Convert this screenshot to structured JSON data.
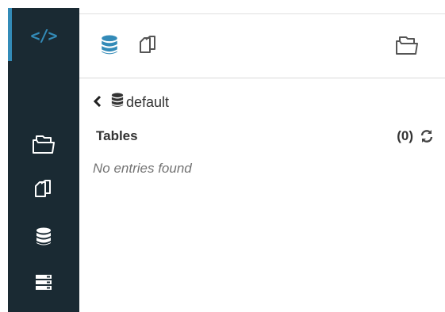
{
  "sidebar": {
    "items": [
      {
        "name": "editor",
        "icon": "code-icon",
        "active": true
      },
      {
        "name": "files",
        "icon": "folder-open-icon"
      },
      {
        "name": "documents",
        "icon": "documents-icon"
      },
      {
        "name": "tables",
        "icon": "database-icon"
      },
      {
        "name": "indexes",
        "icon": "server-icon"
      }
    ],
    "code_glyph": "</>"
  },
  "header": {
    "left_icons": [
      "database-icon",
      "documents-icon"
    ],
    "right_icon": "folder-open-icon"
  },
  "breadcrumb": {
    "label": "default"
  },
  "tables": {
    "label": "Tables",
    "count": "(0)",
    "empty_text": "No entries found"
  },
  "colors": {
    "sidebar_bg": "#1a2a33",
    "accent": "#338bb8",
    "text": "#333333",
    "muted": "#737373"
  }
}
